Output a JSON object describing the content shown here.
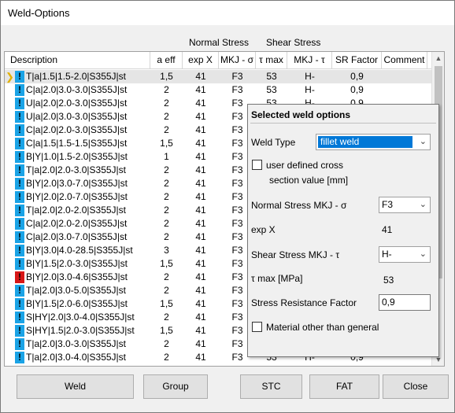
{
  "window": {
    "title": "Weld-Options"
  },
  "group_headers": {
    "normal": "Normal Stress",
    "shear": "Shear Stress"
  },
  "columns": [
    "Description",
    "a eff",
    "exp X",
    "MKJ - σ",
    "τ max",
    "MKJ - τ",
    "SR Factor",
    "Comment"
  ],
  "rows": [
    {
      "badge": "!",
      "err": false,
      "desc": "T|a|1.5|1.5-2.0|S355J|st",
      "aeff": "1,5",
      "expx": "41",
      "mkj_s": "F3",
      "tmax": "53",
      "mkj_t": "H-",
      "sr": "0,9"
    },
    {
      "badge": "!",
      "err": false,
      "desc": "C|a|2.0|3.0-3.0|S355J|st",
      "aeff": "2",
      "expx": "41",
      "mkj_s": "F3",
      "tmax": "53",
      "mkj_t": "H-",
      "sr": "0,9"
    },
    {
      "badge": "!",
      "err": false,
      "desc": "U|a|2.0|2.0-3.0|S355J|st",
      "aeff": "2",
      "expx": "41",
      "mkj_s": "F3",
      "tmax": "53",
      "mkj_t": "H-",
      "sr": "0,9"
    },
    {
      "badge": "!",
      "err": false,
      "desc": "U|a|2.0|3.0-3.0|S355J|st",
      "aeff": "2",
      "expx": "41",
      "mkj_s": "F3",
      "tmax": "",
      "mkj_t": "",
      "sr": ""
    },
    {
      "badge": "!",
      "err": false,
      "desc": "C|a|2.0|2.0-3.0|S355J|st",
      "aeff": "2",
      "expx": "41",
      "mkj_s": "F3",
      "tmax": "",
      "mkj_t": "",
      "sr": ""
    },
    {
      "badge": "!",
      "err": false,
      "desc": "C|a|1.5|1.5-1.5|S355J|st",
      "aeff": "1,5",
      "expx": "41",
      "mkj_s": "F3",
      "tmax": "",
      "mkj_t": "",
      "sr": ""
    },
    {
      "badge": "!",
      "err": false,
      "desc": "B|Y|1.0|1.5-2.0|S355J|st",
      "aeff": "1",
      "expx": "41",
      "mkj_s": "F3",
      "tmax": "",
      "mkj_t": "",
      "sr": ""
    },
    {
      "badge": "!",
      "err": false,
      "desc": "T|a|2.0|2.0-3.0|S355J|st",
      "aeff": "2",
      "expx": "41",
      "mkj_s": "F3",
      "tmax": "",
      "mkj_t": "",
      "sr": ""
    },
    {
      "badge": "!",
      "err": false,
      "desc": "B|Y|2.0|3.0-7.0|S355J|st",
      "aeff": "2",
      "expx": "41",
      "mkj_s": "F3",
      "tmax": "",
      "mkj_t": "",
      "sr": ""
    },
    {
      "badge": "!",
      "err": false,
      "desc": "B|Y|2.0|2.0-7.0|S355J|st",
      "aeff": "2",
      "expx": "41",
      "mkj_s": "F3",
      "tmax": "",
      "mkj_t": "",
      "sr": ""
    },
    {
      "badge": "!",
      "err": false,
      "desc": "T|a|2.0|2.0-2.0|S355J|st",
      "aeff": "2",
      "expx": "41",
      "mkj_s": "F3",
      "tmax": "",
      "mkj_t": "",
      "sr": ""
    },
    {
      "badge": "!",
      "err": false,
      "desc": "C|a|2.0|2.0-2.0|S355J|st",
      "aeff": "2",
      "expx": "41",
      "mkj_s": "F3",
      "tmax": "",
      "mkj_t": "",
      "sr": ""
    },
    {
      "badge": "!",
      "err": false,
      "desc": "C|a|2.0|3.0-7.0|S355J|st",
      "aeff": "2",
      "expx": "41",
      "mkj_s": "F3",
      "tmax": "",
      "mkj_t": "",
      "sr": ""
    },
    {
      "badge": "!",
      "err": false,
      "desc": "B|Y|3.0|4.0-28.5|S355J|st",
      "aeff": "3",
      "expx": "41",
      "mkj_s": "F3",
      "tmax": "",
      "mkj_t": "",
      "sr": ""
    },
    {
      "badge": "!",
      "err": false,
      "desc": "B|Y|1.5|2.0-3.0|S355J|st",
      "aeff": "1,5",
      "expx": "41",
      "mkj_s": "F3",
      "tmax": "",
      "mkj_t": "",
      "sr": ""
    },
    {
      "badge": "!",
      "err": true,
      "desc": "B|Y|2.0|3.0-4.6|S355J|st",
      "aeff": "2",
      "expx": "41",
      "mkj_s": "F3",
      "tmax": "",
      "mkj_t": "",
      "sr": ""
    },
    {
      "badge": "!",
      "err": false,
      "desc": "T|a|2.0|3.0-5.0|S355J|st",
      "aeff": "2",
      "expx": "41",
      "mkj_s": "F3",
      "tmax": "",
      "mkj_t": "",
      "sr": ""
    },
    {
      "badge": "!",
      "err": false,
      "desc": "B|Y|1.5|2.0-6.0|S355J|st",
      "aeff": "1,5",
      "expx": "41",
      "mkj_s": "F3",
      "tmax": "",
      "mkj_t": "",
      "sr": ""
    },
    {
      "badge": "!",
      "err": false,
      "desc": "S|HY|2.0|3.0-4.0|S355J|st",
      "aeff": "2",
      "expx": "41",
      "mkj_s": "F3",
      "tmax": "",
      "mkj_t": "",
      "sr": ""
    },
    {
      "badge": "!",
      "err": false,
      "desc": "S|HY|1.5|2.0-3.0|S355J|st",
      "aeff": "1,5",
      "expx": "41",
      "mkj_s": "F3",
      "tmax": "",
      "mkj_t": "",
      "sr": ""
    },
    {
      "badge": "!",
      "err": false,
      "desc": "T|a|2.0|3.0-3.0|S355J|st",
      "aeff": "2",
      "expx": "41",
      "mkj_s": "F3",
      "tmax": "",
      "mkj_t": "",
      "sr": ""
    },
    {
      "badge": "!",
      "err": false,
      "desc": "T|a|2.0|3.0-4.0|S355J|st",
      "aeff": "2",
      "expx": "41",
      "mkj_s": "F3",
      "tmax": "53",
      "mkj_t": "H-",
      "sr": "0,9"
    }
  ],
  "popup": {
    "title": "Selected weld options",
    "weld_type_label": "Weld Type",
    "weld_type_value": "fillet weld",
    "user_defined_label": "user defined cross",
    "user_defined_label2": "section value [mm]",
    "normal_stress_label": "Normal Stress MKJ - σ",
    "normal_stress_value": "F3",
    "exp_x_label": "exp X",
    "exp_x_value": "41",
    "shear_stress_label": "Shear Stress MKJ - τ",
    "shear_stress_value": "H-",
    "tau_max_label": "τ max [MPa]",
    "tau_max_value": "53",
    "sr_factor_label": "Stress Resistance Factor",
    "sr_factor_value": "0,9",
    "material_label": "Material other than general"
  },
  "buttons": {
    "weld": "Weld",
    "group": "Group",
    "stc": "STC",
    "fat": "FAT",
    "close": "Close"
  }
}
